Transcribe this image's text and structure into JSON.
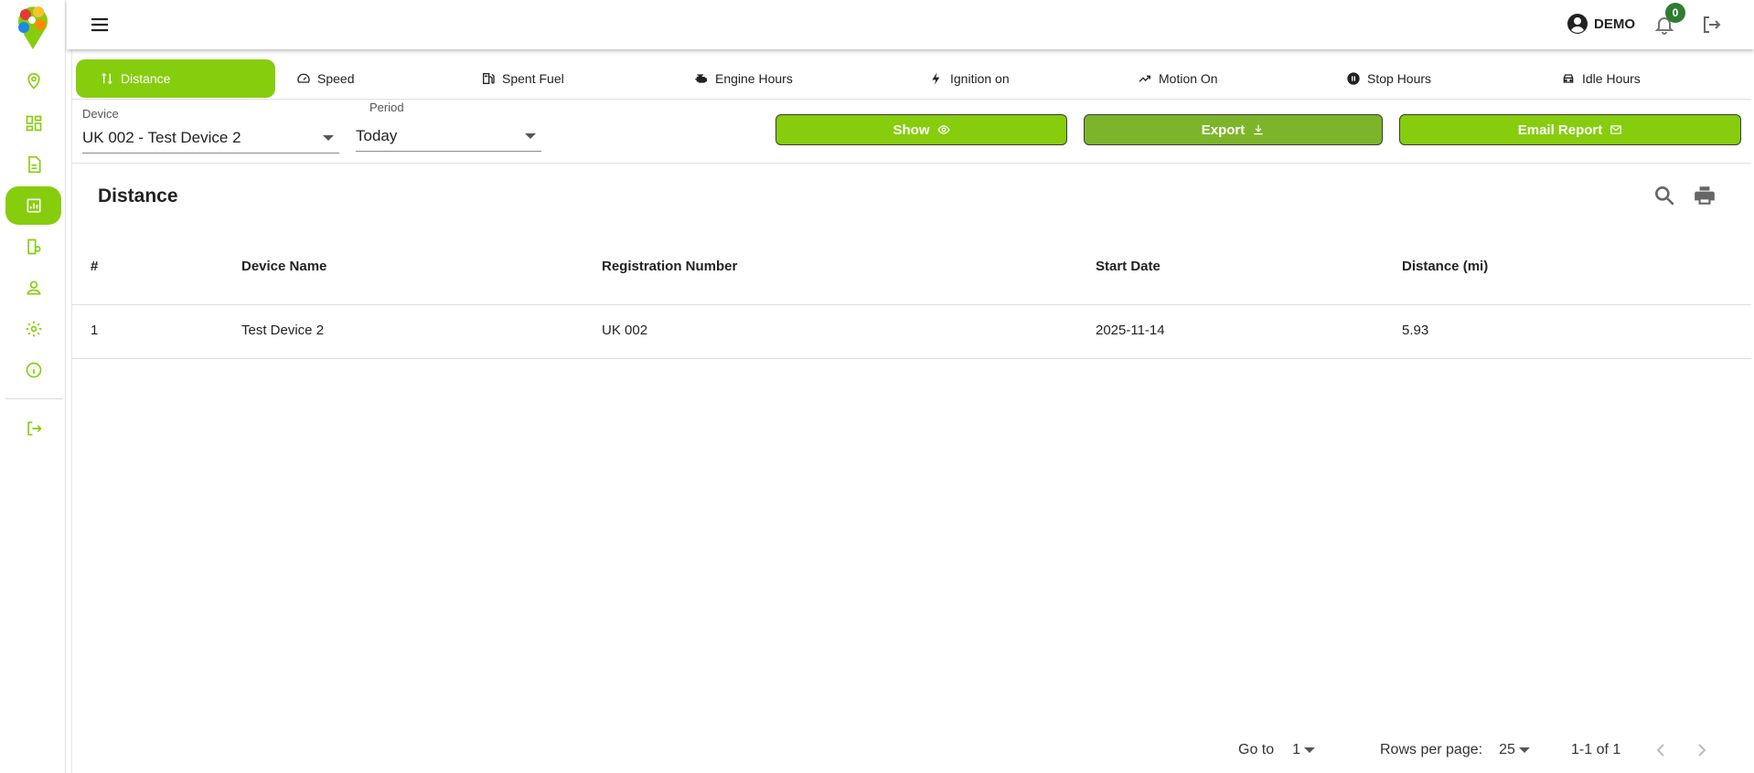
{
  "colors": {
    "accent": "#86cd0d",
    "badge": "#2e7d32"
  },
  "sidebar": {
    "items": [
      {
        "name": "location-pin-icon"
      },
      {
        "name": "dashboard-icon"
      },
      {
        "name": "document-icon"
      },
      {
        "name": "reports-icon",
        "active": true
      },
      {
        "name": "device-settings-icon"
      },
      {
        "name": "user-icon"
      },
      {
        "name": "gear-icon"
      },
      {
        "name": "info-icon"
      },
      {
        "name": "logout-icon"
      }
    ]
  },
  "header": {
    "user": "DEMO",
    "notifications": "0"
  },
  "tabs": [
    {
      "label": "Distance",
      "icon": "distance-icon",
      "active": true
    },
    {
      "label": "Speed",
      "icon": "speedometer-icon"
    },
    {
      "label": "Spent Fuel",
      "icon": "fuel-pump-icon"
    },
    {
      "label": "Engine Hours",
      "icon": "engine-icon"
    },
    {
      "label": "Ignition on",
      "icon": "lightning-icon"
    },
    {
      "label": "Motion On",
      "icon": "trending-up-icon"
    },
    {
      "label": "Stop Hours",
      "icon": "pause-circle-icon"
    },
    {
      "label": "Idle Hours",
      "icon": "car-icon"
    }
  ],
  "filters": {
    "device_label": "Device",
    "device_value": "UK 002 - Test Device 2",
    "period_label": "Period",
    "period_value": "Today"
  },
  "actions": {
    "show": "Show",
    "export": "Export",
    "email": "Email Report"
  },
  "report": {
    "title": "Distance",
    "columns": [
      "#",
      "Device Name",
      "Registration Number",
      "Start Date",
      "Distance (mi)"
    ],
    "rows": [
      [
        "1",
        "Test Device 2",
        "UK 002",
        "2025-11-14",
        "5.93"
      ]
    ]
  },
  "pagination": {
    "goto_label": "Go to",
    "goto_value": "1",
    "rows_label": "Rows per page:",
    "rows_value": "25",
    "range": "1-1 of 1"
  }
}
